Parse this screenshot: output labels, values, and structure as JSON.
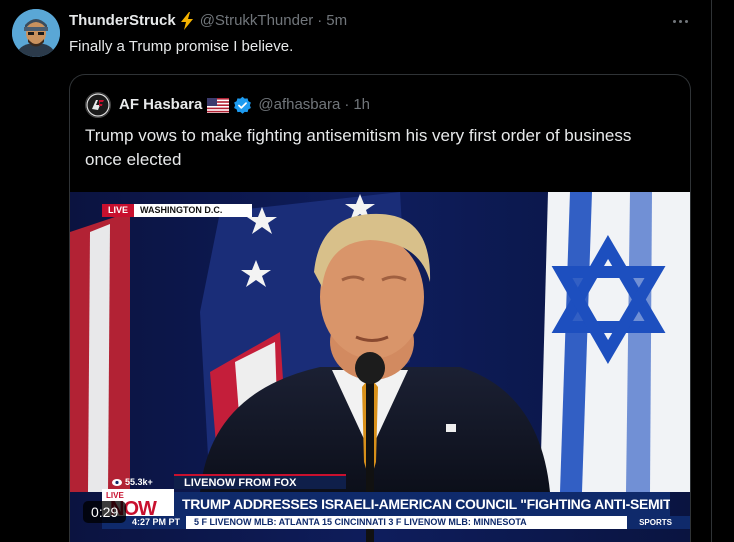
{
  "post": {
    "author": {
      "display_name": "ThunderStruck",
      "handle": "@StrukkThunder",
      "time": "5m"
    },
    "text": "Finally a Trump promise I believe."
  },
  "quoted": {
    "author": {
      "display_name": "AF Hasbara",
      "handle": "@afhasbara",
      "time": "1h"
    },
    "text": "Trump vows to make fighting antisemitism his very first order of business once elected",
    "media": {
      "duration": "0:29",
      "overlay": {
        "live_label": "LIVE",
        "location": "WASHINGTON D.C.",
        "source": "LIVENOW FROM FOX",
        "viewers": "55.3k+",
        "brand_live": "LIVE",
        "brand_now": "NOW",
        "headline": "TRUMP ADDRESSES ISRAELI-AMERICAN COUNCIL \"FIGHTING ANTI-SEMITISM\" EVENT",
        "clock": "4:27 PM PT",
        "ticker": "5  F  LIVENOW  MLB:  ATLANTA  15  CINCINNATI  3  F  LIVENOW  MLB:  MINNESOTA",
        "ticker_section": "SPORTS"
      }
    }
  },
  "icons": {
    "more": "more-horizontal-icon",
    "bolt": "lightning-bolt-emoji",
    "flag": "us-flag-emoji",
    "verified": "verified-badge-icon"
  },
  "colors": {
    "background": "#000000",
    "text_primary": "#e7e9ea",
    "text_secondary": "#71767b",
    "border": "#2f3336",
    "verified_blue": "#1d9bf0",
    "news_red": "#c8102e",
    "news_navy": "#0f2a6b"
  }
}
